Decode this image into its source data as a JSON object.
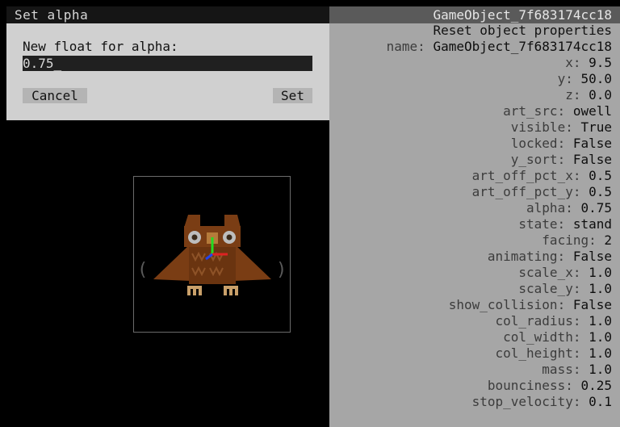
{
  "dialog": {
    "title": "Set alpha",
    "prompt": "New float for alpha:",
    "input_value": "0.75_",
    "cancel_label": "Cancel",
    "set_label": "Set"
  },
  "viewport": {
    "prev_arrow": "(",
    "next_arrow": ")",
    "sprite_icon": "owl-sprite"
  },
  "properties": {
    "title": "GameObject_7f683174cc18",
    "reset_label": "Reset object properties",
    "items": [
      {
        "key": "name: ",
        "value": "GameObject_7f683174cc18"
      },
      {
        "key": "x: ",
        "value": "9.5"
      },
      {
        "key": "y: ",
        "value": "50.0"
      },
      {
        "key": "z: ",
        "value": "0.0"
      },
      {
        "key": "art_src: ",
        "value": "owell"
      },
      {
        "key": "visible: ",
        "value": "True"
      },
      {
        "key": "locked: ",
        "value": "False"
      },
      {
        "key": "y_sort: ",
        "value": "False"
      },
      {
        "key": "art_off_pct_x: ",
        "value": "0.5"
      },
      {
        "key": "art_off_pct_y: ",
        "value": "0.5"
      },
      {
        "key": "alpha: ",
        "value": "0.75"
      },
      {
        "key": "state: ",
        "value": "stand"
      },
      {
        "key": "facing: ",
        "value": "2"
      },
      {
        "key": "animating: ",
        "value": "False"
      },
      {
        "key": "scale_x: ",
        "value": "1.0"
      },
      {
        "key": "scale_y: ",
        "value": "1.0"
      },
      {
        "key": "show_collision: ",
        "value": "False"
      },
      {
        "key": "col_radius: ",
        "value": "1.0"
      },
      {
        "key": "col_width: ",
        "value": "1.0"
      },
      {
        "key": "col_height: ",
        "value": "1.0"
      },
      {
        "key": "mass: ",
        "value": "1.0"
      },
      {
        "key": "bounciness: ",
        "value": "0.25"
      },
      {
        "key": "stop_velocity: ",
        "value": "0.1"
      }
    ]
  },
  "colors": {
    "panel_bg": "#a6a6a6",
    "dialog_bg": "#d0d0d0",
    "owl_brown": "#7a3d14",
    "owl_tan": "#c9a06a"
  }
}
